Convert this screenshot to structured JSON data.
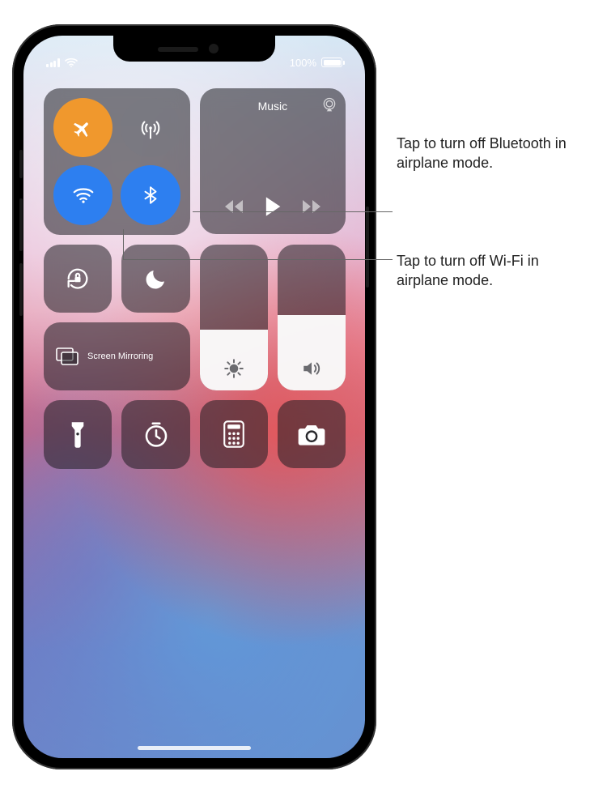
{
  "status": {
    "battery_text": "100%"
  },
  "connectivity": {
    "airplane": {
      "name": "airplane-mode-toggle",
      "active_color": "#f0982d"
    },
    "cellular": {
      "name": "cellular-data-toggle"
    },
    "wifi": {
      "name": "wifi-toggle",
      "active_color": "#2d7ff0"
    },
    "bluetooth": {
      "name": "bluetooth-toggle",
      "active_color": "#2d7ff0"
    }
  },
  "music": {
    "title": "Music"
  },
  "orientation_lock": {
    "name": "orientation-lock-toggle"
  },
  "dnd": {
    "name": "do-not-disturb-toggle"
  },
  "screen_mirroring": {
    "label": "Screen Mirroring"
  },
  "brightness": {
    "level_percent": 42
  },
  "volume": {
    "level_percent": 52
  },
  "shortcuts": {
    "flashlight": {
      "name": "flashlight-button"
    },
    "timer": {
      "name": "timer-button"
    },
    "calculator": {
      "name": "calculator-button"
    },
    "camera": {
      "name": "camera-button"
    }
  },
  "callouts": {
    "bluetooth": "Tap to turn off Bluetooth in airplane mode.",
    "wifi": "Tap to turn off Wi-Fi in airplane mode."
  }
}
